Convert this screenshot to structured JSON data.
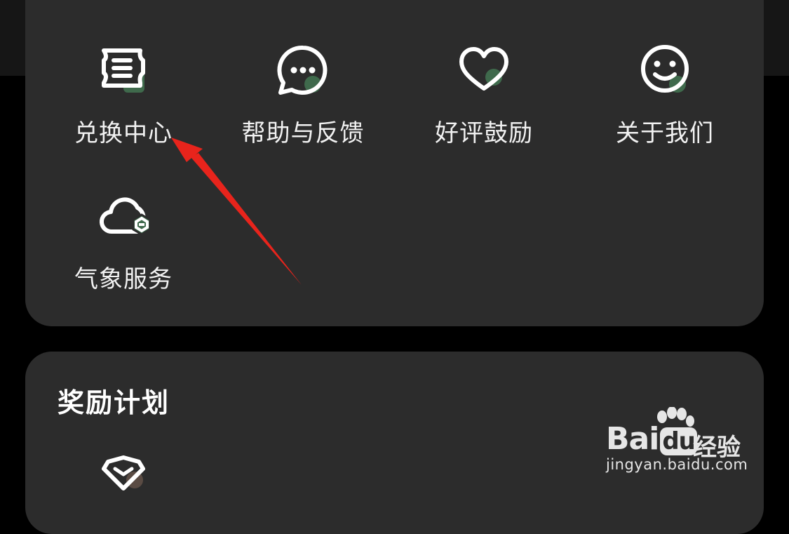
{
  "services": {
    "items": [
      {
        "label": "兑换中心",
        "icon": "ticket-icon"
      },
      {
        "label": "帮助与反馈",
        "icon": "chat-bubble-icon"
      },
      {
        "label": "好评鼓励",
        "icon": "heart-icon"
      },
      {
        "label": "关于我们",
        "icon": "smiley-icon"
      },
      {
        "label": "气象服务",
        "icon": "cloud-icon"
      }
    ]
  },
  "rewards": {
    "title": "奖励计划",
    "first_icon": "diamond-icon"
  },
  "watermark": {
    "logo_bai": "Bai",
    "logo_du": "du",
    "logo_jingyan": "经验",
    "url": "jingyan.baidu.com"
  },
  "colors": {
    "card_bg": "#2c2c2c",
    "page_bg": "#000000",
    "icon_stroke": "#ffffff",
    "icon_accent": "#3f6a4c",
    "arrow": "#e8241c"
  }
}
